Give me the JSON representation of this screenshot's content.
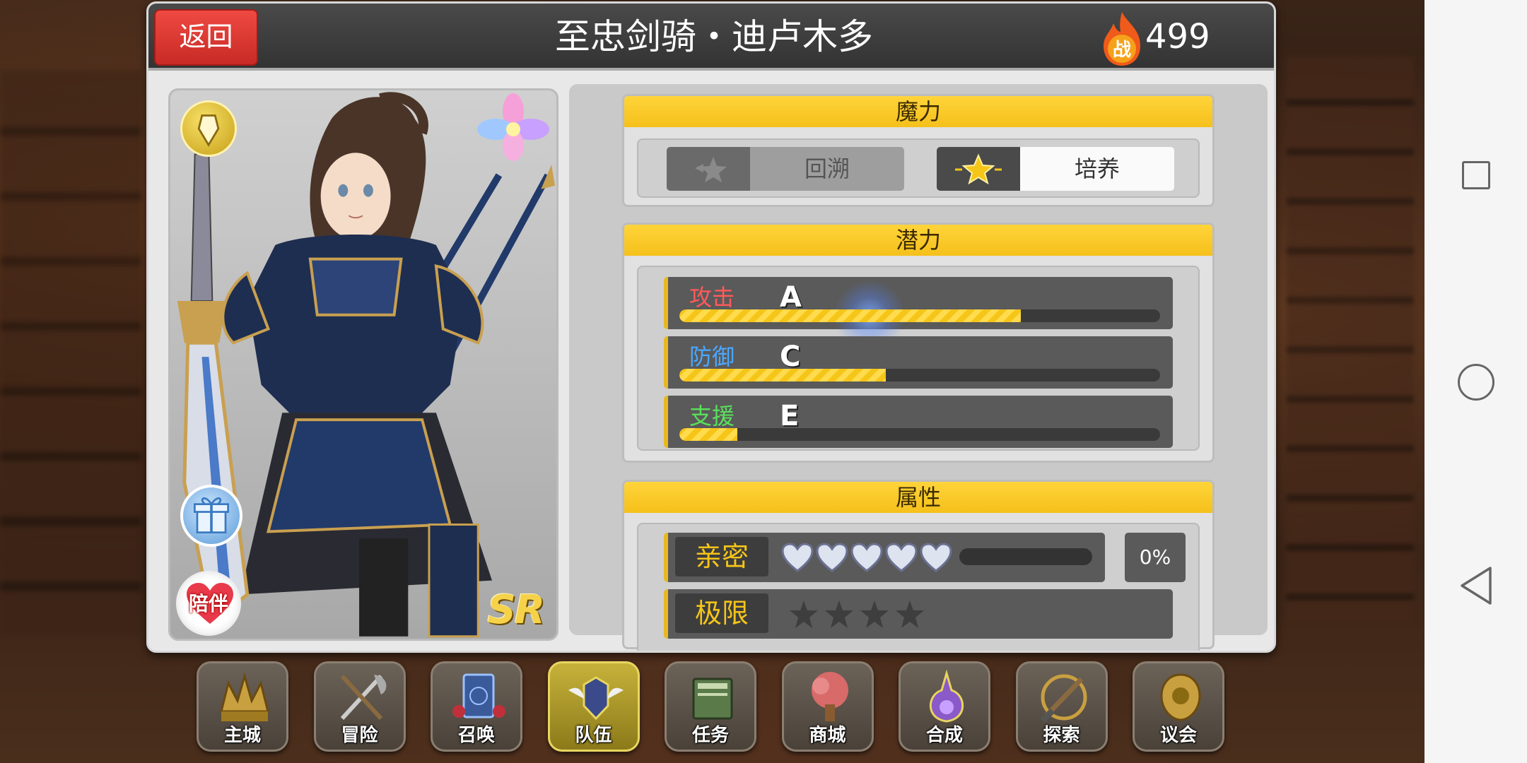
{
  "header": {
    "back_label": "返回",
    "title": "至忠剑骑・迪卢木多",
    "power_icon_text": "战",
    "power_value": "499"
  },
  "character": {
    "rarity": "SR",
    "accompany_label": "陪伴"
  },
  "magic": {
    "title": "魔力",
    "rewind_label": "回溯",
    "train_label": "培养"
  },
  "potential": {
    "title": "潜力",
    "stats": [
      {
        "name": "攻击",
        "grade": "A",
        "fill": 0.71,
        "color": "#ff5a5a"
      },
      {
        "name": "防御",
        "grade": "C",
        "fill": 0.43,
        "color": "#4aa8ff"
      },
      {
        "name": "支援",
        "grade": "E",
        "fill": 0.12,
        "color": "#5ae05a"
      }
    ]
  },
  "attributes": {
    "title": "属性",
    "intimacy_label": "亲密",
    "intimacy_hearts": 5,
    "intimacy_percent": "0%",
    "limit_label": "极限",
    "limit_stars": 4
  },
  "menu": [
    {
      "label": "主城",
      "icon": "castle-crown-icon"
    },
    {
      "label": "冒险",
      "icon": "sword-axe-icon"
    },
    {
      "label": "召唤",
      "icon": "summon-card-icon"
    },
    {
      "label": "队伍",
      "icon": "team-emblem-icon",
      "active": true
    },
    {
      "label": "任务",
      "icon": "quest-book-icon"
    },
    {
      "label": "商城",
      "icon": "shop-tree-icon"
    },
    {
      "label": "合成",
      "icon": "potion-flask-icon"
    },
    {
      "label": "探索",
      "icon": "compass-shovel-icon"
    },
    {
      "label": "议会",
      "icon": "council-crest-icon"
    }
  ]
}
